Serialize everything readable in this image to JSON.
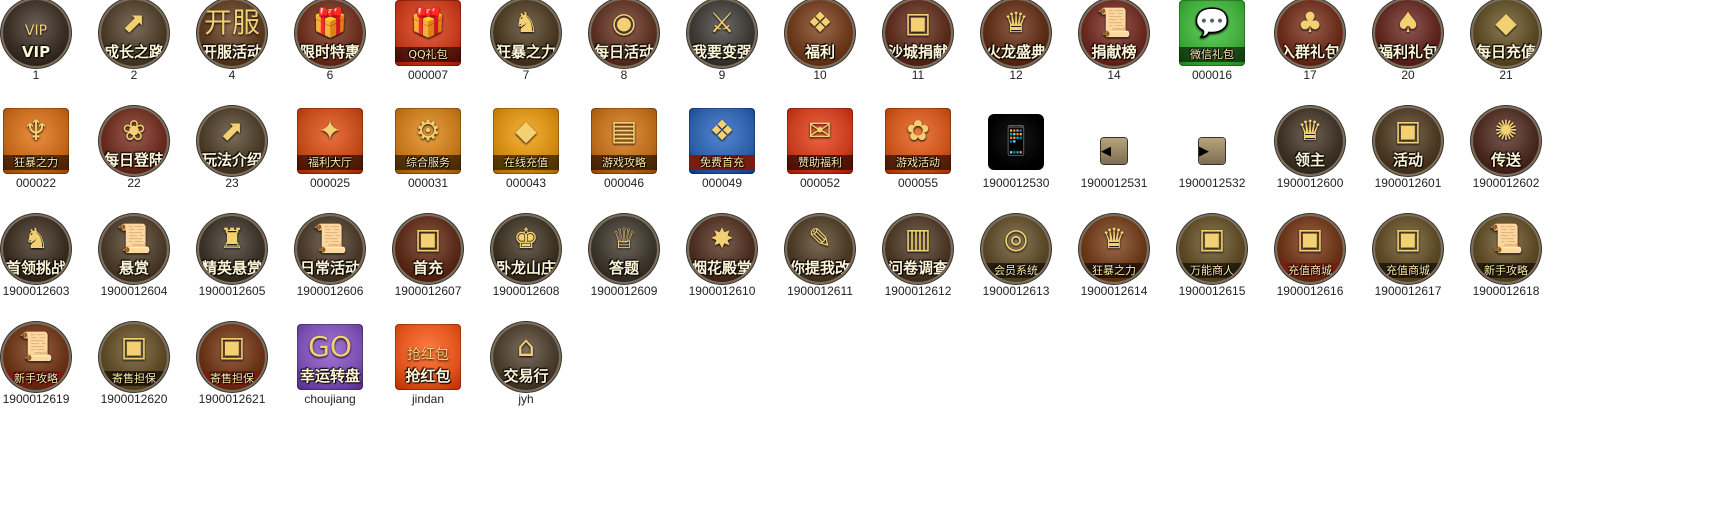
{
  "window_title": "",
  "items": [
    {
      "name": "1",
      "caption": "VIP",
      "icon": "vip-crown-icon",
      "glyph": "VIP",
      "shape": "round",
      "bg": "#3a2f25",
      "cap_style": "plain"
    },
    {
      "name": "2",
      "caption": "成长之路",
      "icon": "green-arrow-icon",
      "glyph": "⬈",
      "shape": "round",
      "bg": "#4b3d2a",
      "cap_style": "plain"
    },
    {
      "name": "4",
      "caption": "开服活动",
      "icon": "open-server-icon",
      "glyph": "开服",
      "shape": "round",
      "bg": "#5a3b22",
      "cap_style": "plain"
    },
    {
      "name": "6",
      "caption": "限时特惠",
      "icon": "gift-box-icon",
      "glyph": "🎁",
      "shape": "round",
      "bg": "#6a2f1e",
      "cap_style": "plain"
    },
    {
      "name": "000007",
      "caption": "QQ礼包",
      "icon": "qq-gift-icon",
      "glyph": "🎁",
      "shape": "sq",
      "bg": "#c23a1c",
      "cap_style": "band"
    },
    {
      "name": "7",
      "caption": "狂暴之力",
      "icon": "beast-head-icon",
      "glyph": "♞",
      "shape": "round",
      "bg": "#4a3a24",
      "cap_style": "plain"
    },
    {
      "name": "8",
      "caption": "每日活动",
      "icon": "sack-icon",
      "glyph": "◉",
      "shape": "round",
      "bg": "#5b3224",
      "cap_style": "plain"
    },
    {
      "name": "9",
      "caption": "我要变强",
      "icon": "crossed-swords-icon",
      "glyph": "⚔",
      "shape": "round",
      "bg": "#3d3a35",
      "cap_style": "plain"
    },
    {
      "name": "10",
      "caption": "福利",
      "icon": "gift-icon",
      "glyph": "❖",
      "shape": "round",
      "bg": "#6b3a1d",
      "cap_style": "plain"
    },
    {
      "name": "11",
      "caption": "沙城捐献",
      "icon": "treasure-chest-icon",
      "glyph": "▣",
      "shape": "round",
      "bg": "#5a2c1e",
      "cap_style": "plain"
    },
    {
      "name": "12",
      "caption": "火龙盛典",
      "icon": "dragon-helmet-icon",
      "glyph": "♛",
      "shape": "round",
      "bg": "#5d2d18",
      "cap_style": "plain"
    },
    {
      "name": "14",
      "caption": "捐献榜",
      "icon": "scroll-icon",
      "glyph": "📜",
      "shape": "round",
      "bg": "#6a2c22",
      "cap_style": "plain"
    },
    {
      "name": "000016",
      "caption": "微信礼包",
      "icon": "wechat-gift-icon",
      "glyph": "💬",
      "shape": "sq",
      "bg": "#3fa93a",
      "cap_style": "band"
    },
    {
      "name": "17",
      "caption": "入群礼包",
      "icon": "bag-icon",
      "glyph": "♣",
      "shape": "round",
      "bg": "#6a2d1c",
      "cap_style": "plain"
    },
    {
      "name": "20",
      "caption": "福利礼包",
      "icon": "red-sack-icon",
      "glyph": "♠",
      "shape": "round",
      "bg": "#5e2720",
      "cap_style": "plain"
    },
    {
      "name": "21",
      "caption": "每日充值",
      "icon": "gold-ingot-icon",
      "glyph": "◆",
      "shape": "round",
      "bg": "#5b4a26",
      "cap_style": "plain"
    },
    {
      "name": "000022",
      "caption": "狂暴之力",
      "icon": "flame-sword-icon",
      "glyph": "♆",
      "shape": "sq",
      "bg": "#c2671a",
      "cap_style": "band"
    },
    {
      "name": "22",
      "caption": "每日登陆",
      "icon": "gift-bag-icon",
      "glyph": "❀",
      "shape": "round",
      "bg": "#6a2d20",
      "cap_style": "plain"
    },
    {
      "name": "23",
      "caption": "玩法介绍",
      "icon": "green-arrow-icon",
      "glyph": "⬈",
      "shape": "round",
      "bg": "#4b3d2a",
      "cap_style": "plain"
    },
    {
      "name": "000025",
      "caption": "福利大厅",
      "icon": "gift-pile-icon",
      "glyph": "✦",
      "shape": "sq",
      "bg": "#c24a18",
      "cap_style": "band"
    },
    {
      "name": "000031",
      "caption": "综合服务",
      "icon": "gear-icon",
      "glyph": "⚙",
      "shape": "sq",
      "bg": "#c2781a",
      "cap_style": "band"
    },
    {
      "name": "000043",
      "caption": "在线充值",
      "icon": "gold-ingot-icon",
      "glyph": "◆",
      "shape": "sq",
      "bg": "#d08a12",
      "cap_style": "band"
    },
    {
      "name": "000046",
      "caption": "游戏攻略",
      "icon": "book-icon",
      "glyph": "▤",
      "shape": "sq",
      "bg": "#b96a1a",
      "cap_style": "band"
    },
    {
      "name": "000049",
      "caption": "免费首充",
      "icon": "gift-ribbon-icon",
      "glyph": "❖",
      "shape": "sq",
      "bg": "#2d5ea8",
      "cap_style": "redband"
    },
    {
      "name": "000052",
      "caption": "赞助福利",
      "icon": "red-envelope-icon",
      "glyph": "✉",
      "shape": "sq",
      "bg": "#c63c1c",
      "cap_style": "band"
    },
    {
      "name": "000055",
      "caption": "游戏活动",
      "icon": "event-icon",
      "glyph": "✿",
      "shape": "sq",
      "bg": "#c8541c",
      "cap_style": "band"
    },
    {
      "name": "1900012530",
      "caption": "",
      "icon": "phone-tools-icon",
      "glyph": "📱",
      "shape": "round-dark",
      "bg": "#0a0a0a",
      "cap_style": "none"
    },
    {
      "name": "1900012531",
      "caption": "",
      "icon": "arrow-left-icon",
      "glyph": "◀",
      "shape": "small",
      "bg": "#7d6d52",
      "cap_style": "none"
    },
    {
      "name": "1900012532",
      "caption": "",
      "icon": "arrow-right-icon",
      "glyph": "▶",
      "shape": "small",
      "bg": "#7d6d52",
      "cap_style": "none"
    },
    {
      "name": "1900012600",
      "caption": "领主",
      "icon": "lord-helmet-icon",
      "glyph": "♛",
      "shape": "round",
      "bg": "#3e3326",
      "cap_style": "plain"
    },
    {
      "name": "1900012601",
      "caption": "活动",
      "icon": "treasure-chest-icon",
      "glyph": "▣",
      "shape": "round",
      "bg": "#4d3a24",
      "cap_style": "plain"
    },
    {
      "name": "1900012602",
      "caption": "传送",
      "icon": "rose-orb-icon",
      "glyph": "✺",
      "shape": "round",
      "bg": "#4b2a22",
      "cap_style": "plain"
    },
    {
      "name": "1900012603",
      "caption": "首领挑战",
      "icon": "demon-head-icon",
      "glyph": "♞",
      "shape": "round",
      "bg": "#3a2e22",
      "cap_style": "plain"
    },
    {
      "name": "1900012604",
      "caption": "悬赏",
      "icon": "scroll-icon",
      "glyph": "📜",
      "shape": "round",
      "bg": "#4b3b2a",
      "cap_style": "plain"
    },
    {
      "name": "1900012605",
      "caption": "精英悬赏",
      "icon": "beast-helmet-icon",
      "glyph": "♜",
      "shape": "round",
      "bg": "#3b3327",
      "cap_style": "plain"
    },
    {
      "name": "1900012606",
      "caption": "日常活动",
      "icon": "scroll-icon",
      "glyph": "📜",
      "shape": "round",
      "bg": "#4a3a2b",
      "cap_style": "plain"
    },
    {
      "name": "1900012607",
      "caption": "首充",
      "icon": "treasure-chest-icon",
      "glyph": "▣",
      "shape": "round",
      "bg": "#5a2b18",
      "cap_style": "plain"
    },
    {
      "name": "1900012608",
      "caption": "卧龙山庄",
      "icon": "dragon-crest-icon",
      "glyph": "♚",
      "shape": "round",
      "bg": "#3d3325",
      "cap_style": "plain"
    },
    {
      "name": "1900012609",
      "caption": "答题",
      "icon": "crown-icon",
      "glyph": "♕",
      "shape": "round",
      "bg": "#3c362d",
      "cap_style": "plain"
    },
    {
      "name": "1900012610",
      "caption": "烟花殿堂",
      "icon": "palace-fireworks-icon",
      "glyph": "✸",
      "shape": "round",
      "bg": "#4d2f22",
      "cap_style": "plain"
    },
    {
      "name": "1900012611",
      "caption": "你提我改",
      "icon": "quill-book-icon",
      "glyph": "✎",
      "shape": "round",
      "bg": "#4b3b26",
      "cap_style": "plain"
    },
    {
      "name": "1900012612",
      "caption": "问卷调查",
      "icon": "survey-scroll-icon",
      "glyph": "▥",
      "shape": "round",
      "bg": "#4a3726",
      "cap_style": "plain"
    },
    {
      "name": "1900012613",
      "caption": "会员系统",
      "icon": "dragon-coin-icon",
      "glyph": "◎",
      "shape": "round",
      "bg": "#5a4a2a",
      "cap_style": "band"
    },
    {
      "name": "1900012614",
      "caption": "狂暴之力",
      "icon": "flame-helmet-icon",
      "glyph": "♛",
      "shape": "round",
      "bg": "#6a3a1a",
      "cap_style": "band"
    },
    {
      "name": "1900012615",
      "caption": "万能商人",
      "icon": "merchant-chest-icon",
      "glyph": "▣",
      "shape": "round",
      "bg": "#5d4a26",
      "cap_style": "band"
    },
    {
      "name": "1900012616",
      "caption": "充值商城",
      "icon": "shop-chest-icon",
      "glyph": "▣",
      "shape": "round",
      "bg": "#6a3418",
      "cap_style": "redband"
    },
    {
      "name": "1900012617",
      "caption": "充值商城",
      "icon": "shop-chest-icon",
      "glyph": "▣",
      "shape": "round",
      "bg": "#5d4a26",
      "cap_style": "band"
    },
    {
      "name": "1900012618",
      "caption": "新手攻略",
      "icon": "scroll-icon",
      "glyph": "📜",
      "shape": "round",
      "bg": "#5d4a26",
      "cap_style": "band"
    },
    {
      "name": "1900012619",
      "caption": "新手攻略",
      "icon": "scroll-icon",
      "glyph": "📜",
      "shape": "round",
      "bg": "#6a3418",
      "cap_style": "redband"
    },
    {
      "name": "1900012620",
      "caption": "寄售担保",
      "icon": "dragon-chest-icon",
      "glyph": "▣",
      "shape": "round",
      "bg": "#5d4a26",
      "cap_style": "band"
    },
    {
      "name": "1900012621",
      "caption": "寄售担保",
      "icon": "dragon-chest-icon",
      "glyph": "▣",
      "shape": "round",
      "bg": "#6a3418",
      "cap_style": "redband"
    },
    {
      "name": "choujiang",
      "caption": "幸运转盘",
      "icon": "lucky-wheel-icon",
      "glyph": "GO",
      "shape": "sq",
      "bg": "#7b4fb0",
      "cap_style": "plain"
    },
    {
      "name": "jindan",
      "caption": "抢红包",
      "icon": "red-envelope-icon",
      "glyph": "抢红包",
      "shape": "sq",
      "bg": "#e0541c",
      "cap_style": "plain"
    },
    {
      "name": "jyh",
      "caption": "交易行",
      "icon": "trading-house-icon",
      "glyph": "⌂",
      "shape": "round",
      "bg": "#4a3d2e",
      "cap_style": "plain"
    }
  ]
}
